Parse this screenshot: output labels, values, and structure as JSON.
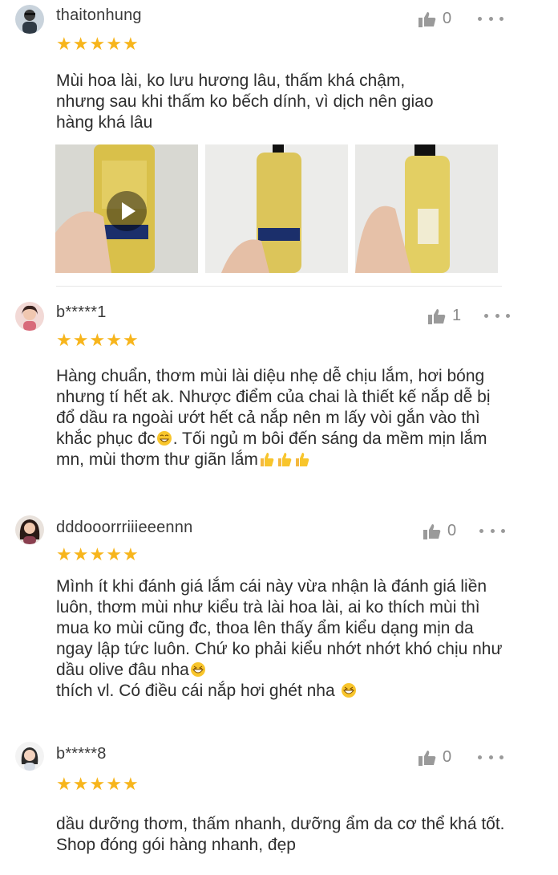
{
  "colors": {
    "star": "#f7b51c",
    "text": "#2d2d2d",
    "muted": "#8a8a8a"
  },
  "icons": {
    "like": "thumbs-up-icon",
    "more": "more-options-icon",
    "star": "star-icon",
    "play": "play-icon"
  },
  "reviews": [
    {
      "username": "thaitonhung",
      "likes": "0",
      "rating": 5,
      "text": "Mùi hoa lài, ko lưu hương lâu, thấm khá chậm, nhưng sau khi thấm ko bếch dính, vì dịch nên giao hàng khá lâu",
      "photos": 3,
      "first_photo_is_video": true
    },
    {
      "username": "b*****1",
      "likes": "1",
      "rating": 5,
      "text": "Hàng chuẩn, thơm mùi lài diệu nhẹ dễ chịu lắm, hơi bóng nhưng tí hết ak. Nhược điểm của chai là thiết kế nắp dễ bị đổ dầu ra ngoài ướt hết cả nắp nên m lấy vòi gắn vào thì khắc phục đc",
      "text2": ". Tối ngủ m bôi đến sáng da mềm mịn lắm mn, mùi thơm thư giãn lắm"
    },
    {
      "username": "dddooorrriiieeennn",
      "likes": "0",
      "rating": 5,
      "text": "Mình ít khi đánh giá lắm cái này vừa nhận là đánh giá liền luôn, thơm mùi như kiểu trà lài hoa lài, ai ko thích mùi thì mua ko mùi cũng đc, thoa lên thấy ẩm kiểu dạng mịn da ngay lập tức luôn. Chứ ko phải kiểu nhớt nhớt khó chịu như dầu olive đâu nha",
      "text2": "thích vl. Có điều cái nắp hơi ghét nha"
    },
    {
      "username": "b*****8",
      "likes": "0",
      "rating": 5,
      "text": "dầu dưỡng thơm, thấm nhanh,  dưỡng ẩm da cơ thể khá tốt. Shop đóng gói hàng nhanh, đẹp"
    }
  ]
}
